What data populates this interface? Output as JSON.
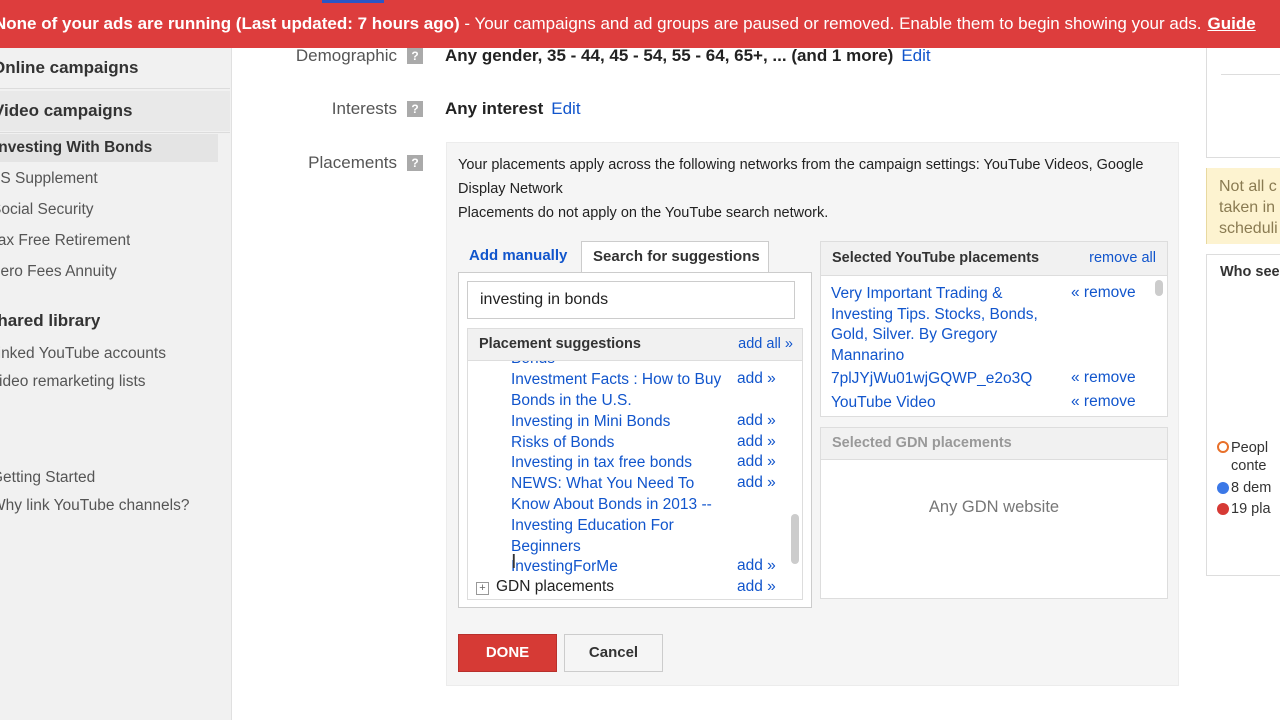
{
  "banner": {
    "alert_text": "None of your ads are running (Last updated: 7 hours ago)",
    "detail_text": " - Your campaigns and ad groups are paused or removed. Enable them to begin showing your ads.",
    "guide_label": "Guide"
  },
  "sidebar": {
    "online_campaigns": "Online campaigns",
    "video_campaigns": "Video campaigns",
    "campaigns": [
      "Investing With Bonds",
      "SS Supplement",
      "Social Security",
      "Tax Free Retirement",
      "Zero Fees Annuity"
    ],
    "shared_library": "Shared library",
    "library_items": [
      "Linked YouTube accounts",
      "Video remarketing lists"
    ],
    "help_items": [
      "Getting Started",
      "Why link YouTube channels?"
    ]
  },
  "targeting": {
    "demographic_label": "Demographic",
    "demographic_value": "Any gender, 35 - 44, 45 - 54, 55 - 64, 65+, ... (and 1 more)",
    "interests_label": "Interests",
    "interests_value": "Any interest",
    "edit_label": "Edit",
    "placements_label": "Placements",
    "help_glyph": "?"
  },
  "placements": {
    "intro_line1": "Your placements apply across the following networks from the campaign settings: YouTube Videos, Google Display Network",
    "intro_line2": "Placements do not apply on the YouTube search network.",
    "tab_add_manually": "Add manually",
    "tab_search": "Search for suggestions",
    "search_value": "investing in bonds",
    "suggestions_title": "Placement suggestions",
    "add_all_label": "add all »",
    "add_label": "add »",
    "suggestions": [
      "Bonds",
      "Investment Facts : How to Buy Bonds in the U.S.",
      "Investing in Mini Bonds",
      "Risks of Bonds",
      "Investing in tax free bonds",
      "NEWS: What You Need To Know About Bonds in 2013 --",
      "Investing Education For Beginners",
      "InvestingForMe"
    ],
    "gdn_placements": "GDN placements",
    "selected_yt_title": "Selected YouTube placements",
    "remove_all_label": "remove all",
    "remove_label": "« remove",
    "selected_yt": [
      "Very Important Trading & Investing Tips. Stocks, Bonds, Gold, Silver. By Gregory Mannarino",
      "7plJYjWu01wjGQWP_e2o3Q",
      "YouTube Video"
    ],
    "selected_gdn_title": "Selected GDN placements",
    "selected_gdn_empty": "Any GDN website",
    "done_label": "DONE",
    "cancel_label": "Cancel"
  },
  "right_panel": {
    "note_lines": [
      "Not all c",
      "taken in",
      "scheduli"
    ],
    "who_title": "Who see",
    "legend": [
      {
        "line1": "Peopl",
        "line2": "conte",
        "color": "#e8702a",
        "hollow": true
      },
      {
        "line1": "8 dem",
        "line2": "",
        "color": "#3b78e7",
        "hollow": false
      },
      {
        "line1": "19 pla",
        "line2": "",
        "color": "#d63a35",
        "hollow": false
      }
    ]
  }
}
